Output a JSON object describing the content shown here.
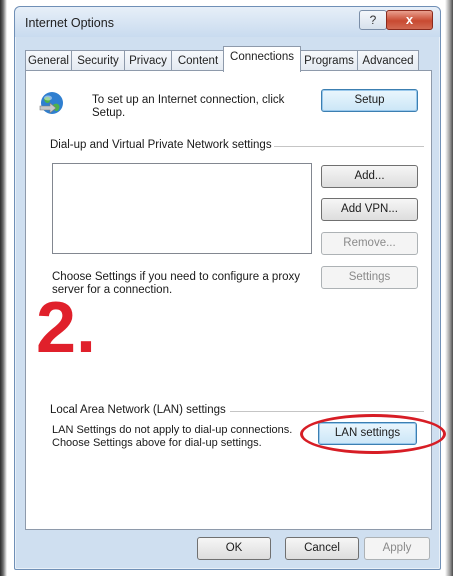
{
  "window": {
    "title": "Internet Options",
    "help_glyph": "?",
    "close_glyph": "x"
  },
  "tabs": [
    {
      "label": "General"
    },
    {
      "label": "Security"
    },
    {
      "label": "Privacy"
    },
    {
      "label": "Content"
    },
    {
      "label": "Connections",
      "active": true
    },
    {
      "label": "Programs"
    },
    {
      "label": "Advanced"
    }
  ],
  "setup": {
    "text_line1": "To set up an Internet connection, click",
    "text_line2": "Setup.",
    "button": "Setup",
    "icon": "network-globe-icon"
  },
  "dialup": {
    "heading": "Dial-up and Virtual Private Network settings",
    "add": "Add...",
    "add_vpn": "Add VPN...",
    "remove": "Remove...",
    "settings": "Settings",
    "proxy_line1": "Choose Settings if you need to configure a proxy",
    "proxy_line2": "server for a connection."
  },
  "annotation": {
    "step": "2.",
    "color": "#e0202b"
  },
  "lan": {
    "heading": "Local Area Network (LAN) settings",
    "line1": "LAN Settings do not apply to dial-up connections.",
    "line2": "Choose Settings above for dial-up settings.",
    "button": "LAN settings"
  },
  "footer": {
    "ok": "OK",
    "cancel": "Cancel",
    "apply": "Apply"
  }
}
